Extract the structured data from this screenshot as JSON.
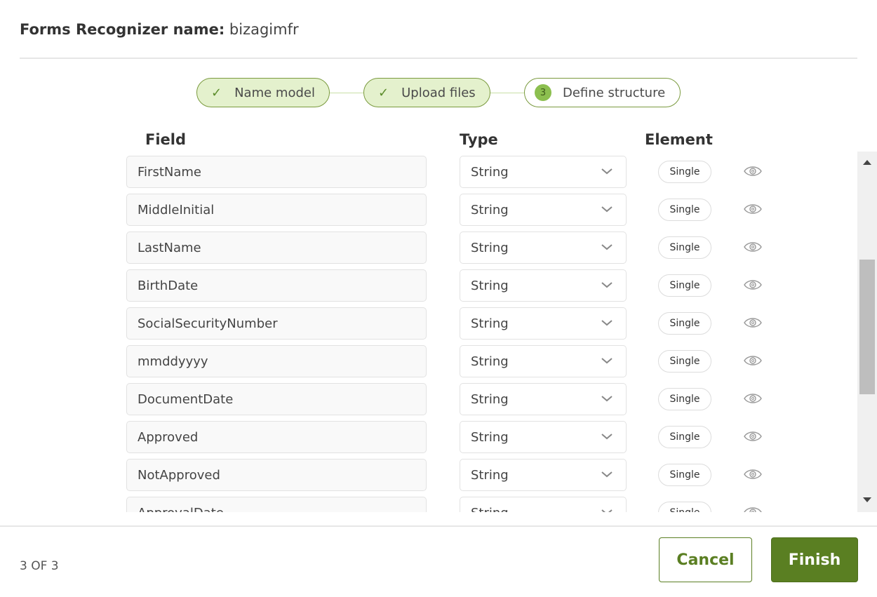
{
  "header": {
    "label": "Forms Recognizer name:",
    "value": "bizagimfr"
  },
  "stepper": {
    "steps": [
      {
        "label": "Name model",
        "status": "completed",
        "icon": "check-icon"
      },
      {
        "label": "Upload files",
        "status": "completed",
        "icon": "check-icon"
      },
      {
        "label": "Define structure",
        "status": "active",
        "number": "3"
      }
    ]
  },
  "columns": {
    "field": "Field",
    "type": "Type",
    "element": "Element"
  },
  "rows": [
    {
      "field": "FirstName",
      "type": "String",
      "element": "Single"
    },
    {
      "field": "MiddleInitial",
      "type": "String",
      "element": "Single"
    },
    {
      "field": "LastName",
      "type": "String",
      "element": "Single"
    },
    {
      "field": "BirthDate",
      "type": "String",
      "element": "Single"
    },
    {
      "field": "SocialSecurityNumber",
      "type": "String",
      "element": "Single"
    },
    {
      "field": "mmddyyyy",
      "type": "String",
      "element": "Single"
    },
    {
      "field": "DocumentDate",
      "type": "String",
      "element": "Single"
    },
    {
      "field": "Approved",
      "type": "String",
      "element": "Single"
    },
    {
      "field": "NotApproved",
      "type": "String",
      "element": "Single"
    },
    {
      "field": "ApprovalDate",
      "type": "String",
      "element": "Single"
    }
  ],
  "footer": {
    "page_indicator": "3 OF 3",
    "cancel_label": "Cancel",
    "finish_label": "Finish"
  },
  "colors": {
    "accent": "#5a7f22",
    "step_done_bg": "#e4f1cd",
    "step_border": "#7a9a3e"
  }
}
